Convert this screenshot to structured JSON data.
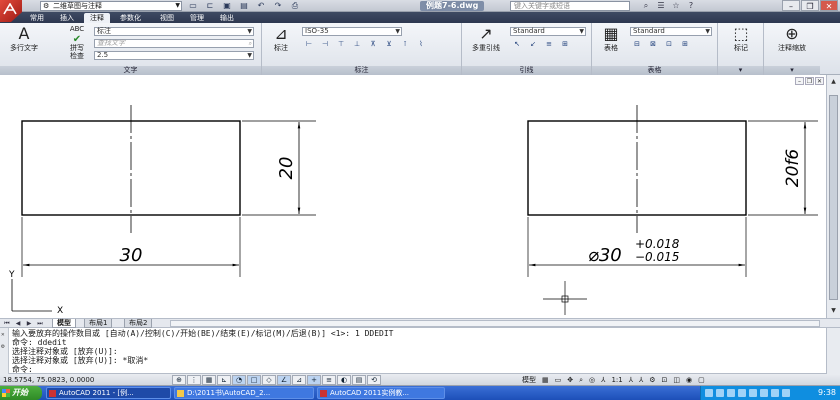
{
  "titlebar": {
    "workspace": "二维草图与注释",
    "document_title": "例题7-6.dwg",
    "search_placeholder": "键入关键字或短语"
  },
  "tabs": [
    "常用",
    "插入",
    "注释",
    "参数化",
    "视图",
    "管理",
    "输出"
  ],
  "active_tab": "注释",
  "ribbon": {
    "text_panel": {
      "mtext_label": "多行文字",
      "spell_label_1": "拼写",
      "spell_label_2": "检查",
      "abc": "ABC",
      "style_value": "标注",
      "find_placeholder": "查找文字",
      "height_value": "2.5",
      "title": "文字"
    },
    "dim_panel": {
      "dim_label": "标注",
      "style_value": "ISO-35",
      "title": "标注"
    },
    "leader_panel": {
      "mleader_label": "多重引线",
      "style_value": "Standard",
      "title": "引线"
    },
    "table_panel": {
      "table_label": "表格",
      "style_value": "Standard",
      "title": "表格"
    },
    "markup_panel": {
      "label": "标记"
    },
    "scale_panel": {
      "label": "注释缩放"
    }
  },
  "drawing": {
    "left_dim_width": "30",
    "left_dim_height": "20",
    "right_dim_height": "20f6",
    "right_dim_width_base": "⌀30",
    "right_dim_upper_tol": "+0.018",
    "right_dim_lower_tol": "−0.015",
    "ucs_x": "X",
    "ucs_y": "Y"
  },
  "layout_tabs": [
    "模型",
    "布局1",
    "布局2"
  ],
  "active_layout": "模型",
  "command": {
    "lines": [
      "输入要放弃的操作数目或 [自动(A)/控制(C)/开始(BE)/结束(E)/标记(M)/后退(B)] <1>: 1 DDEDIT",
      "命令: ddedit",
      "选择注释对象或 [放弃(U)]:",
      "选择注释对象或 [放弃(U)]: *取消*",
      "命令:"
    ]
  },
  "status": {
    "coords": "18.5754, 75.0823, 0.0000",
    "model": "模型",
    "scale": "1:1",
    "clock": "9:38"
  },
  "taskbar": {
    "start_label": "开始",
    "tasks": [
      "AutoCAD 2011 - [例...",
      "D:\\2011书\\AutoCAD_2...",
      "AutoCAD 2011实例教..."
    ]
  }
}
